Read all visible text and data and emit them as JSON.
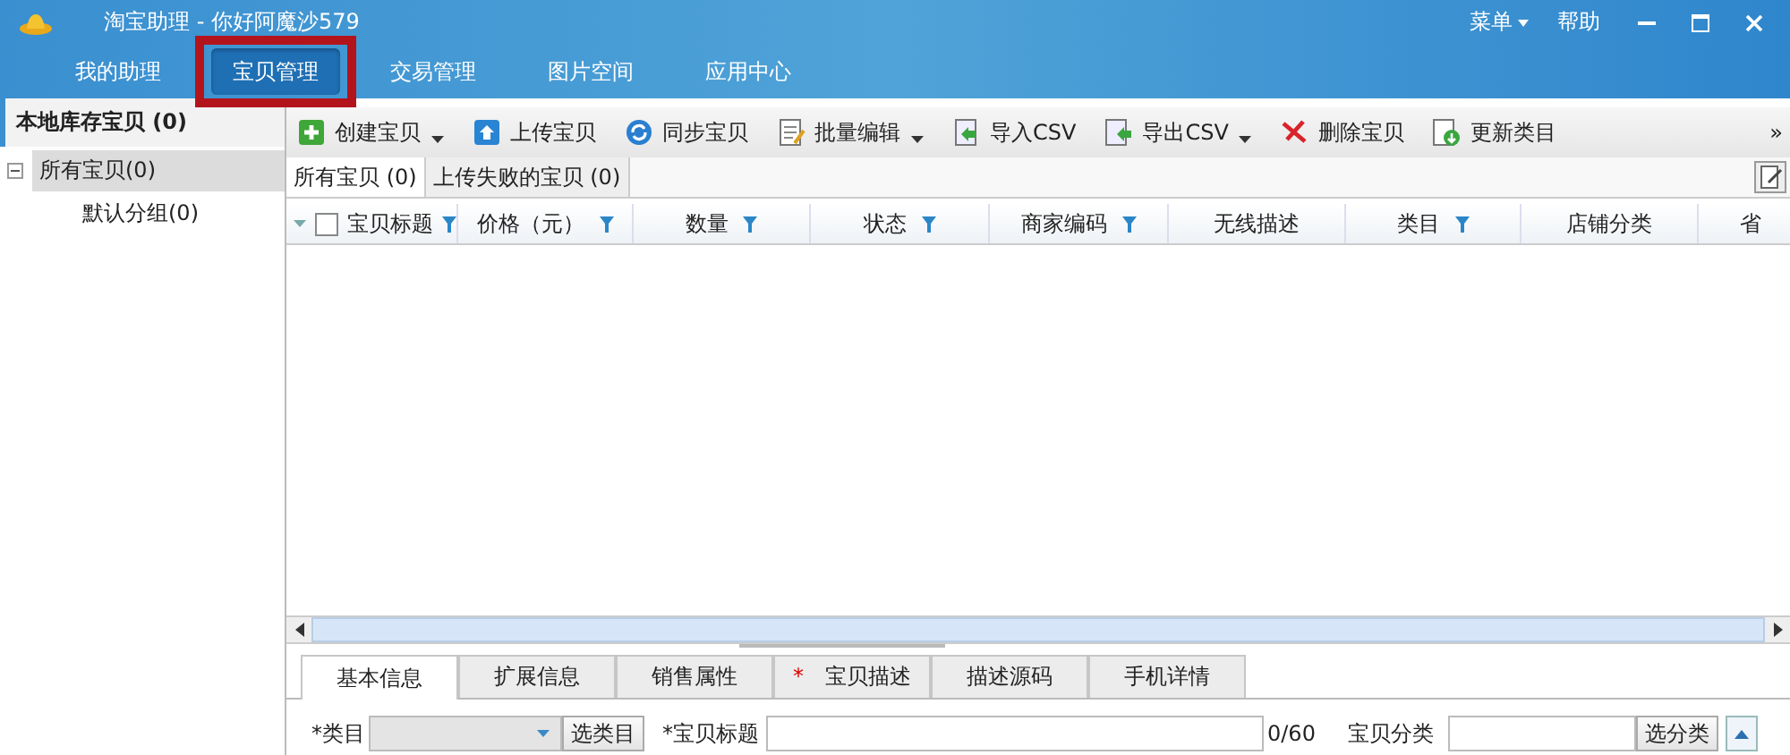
{
  "window": {
    "title": "淘宝助理 - 你好阿魔沙579",
    "menu": "菜单",
    "help": "帮助"
  },
  "nav": [
    {
      "label": "我的助理",
      "selected": false,
      "highlighted": false
    },
    {
      "label": "宝贝管理",
      "selected": true,
      "highlighted": true
    },
    {
      "label": "交易管理",
      "selected": false,
      "highlighted": false
    },
    {
      "label": "图片空间",
      "selected": false,
      "highlighted": false
    },
    {
      "label": "应用中心",
      "selected": false,
      "highlighted": false
    }
  ],
  "sidebar": {
    "title": "本地库存宝贝 (0)",
    "tree": [
      {
        "label": "所有宝贝(0)",
        "selected": true,
        "expanded": true,
        "children": [
          {
            "label": "默认分组(0)",
            "selected": false
          }
        ]
      }
    ]
  },
  "toolbar": [
    {
      "label": "创建宝贝",
      "dropdown": true
    },
    {
      "label": "上传宝贝",
      "dropdown": false
    },
    {
      "label": "同步宝贝",
      "dropdown": false
    },
    {
      "label": "批量编辑",
      "dropdown": true
    },
    {
      "label": "导入CSV",
      "dropdown": false
    },
    {
      "label": "导出CSV",
      "dropdown": true
    },
    {
      "label": "删除宝贝",
      "dropdown": false
    },
    {
      "label": "更新类目",
      "dropdown": false
    }
  ],
  "toolbar_more": "»",
  "subtabs": [
    {
      "label": "所有宝贝 (0)",
      "selected": true
    },
    {
      "label": "上传失败的宝贝 (0)",
      "selected": false
    }
  ],
  "table": {
    "select_all": false,
    "columns": [
      {
        "label": "宝贝标题",
        "filter": true
      },
      {
        "label": "价格（元）",
        "filter": true
      },
      {
        "label": "数量",
        "filter": true
      },
      {
        "label": "状态",
        "filter": true
      },
      {
        "label": "商家编码",
        "filter": true
      },
      {
        "label": "无线描述",
        "filter": false
      },
      {
        "label": "类目",
        "filter": true
      },
      {
        "label": "店铺分类",
        "filter": false
      },
      {
        "label": "省",
        "filter": false
      }
    ]
  },
  "detail_tabs": [
    {
      "label": "基本信息",
      "selected": true,
      "required": false
    },
    {
      "label": "扩展信息",
      "selected": false,
      "required": false
    },
    {
      "label": "销售属性",
      "selected": false,
      "required": false
    },
    {
      "label": "宝贝描述",
      "selected": false,
      "required": true,
      "marker": "*"
    },
    {
      "label": "描述源码",
      "selected": false,
      "required": false
    },
    {
      "label": "手机详情",
      "selected": false,
      "required": false
    }
  ],
  "form": {
    "category_label": "*类目",
    "category_button": "选类目",
    "title_label": "*宝贝标题",
    "title_counter": "0/60",
    "shop_category_label": "宝贝分类",
    "shop_category_button": "选分类"
  }
}
